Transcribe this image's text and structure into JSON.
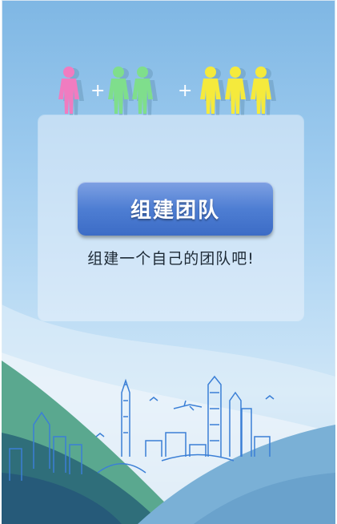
{
  "team_builder": {
    "button_label": "组建团队",
    "subtitle": "组建一个自己的团队吧!",
    "figure_groups": [
      {
        "count": 1,
        "color": "#f07cc0"
      },
      {
        "count": 2,
        "color": "#7fde8c"
      },
      {
        "count": 3,
        "color": "#f5ea3c"
      }
    ],
    "plus_sign": "+"
  },
  "colors": {
    "accent": "#4e7ed3",
    "background": "#9ccaee",
    "skyline_line": "#3b7fd6",
    "wave_dark": "#2f6e7a",
    "wave_light": "#7ab0d6"
  },
  "illustration": "city-skyline"
}
